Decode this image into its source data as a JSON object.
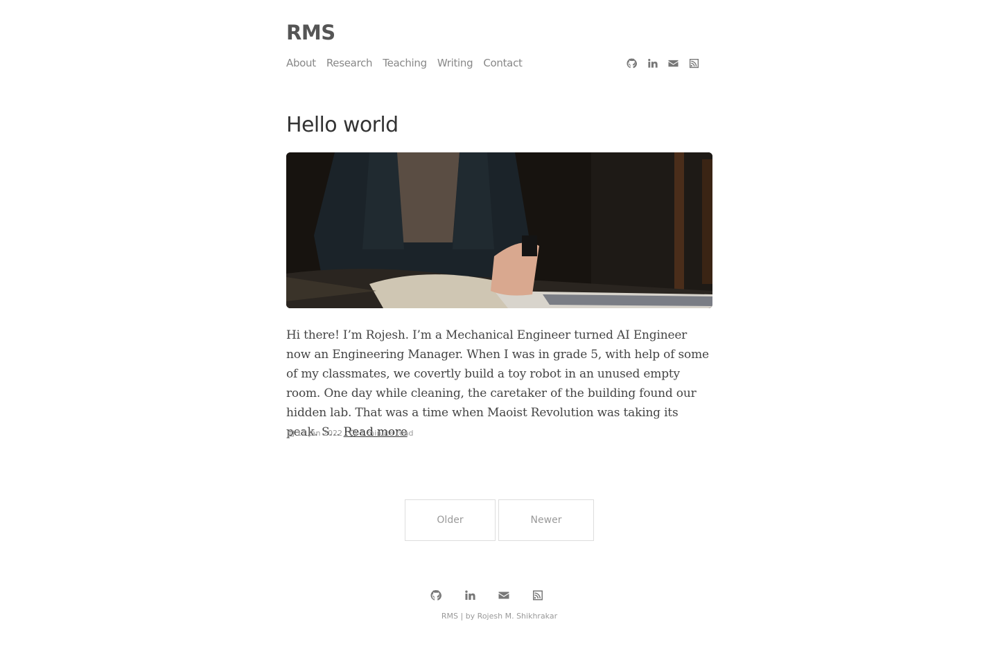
{
  "site": {
    "title": "RMS"
  },
  "nav": {
    "items": [
      {
        "label": "About"
      },
      {
        "label": "Research"
      },
      {
        "label": "Teaching"
      },
      {
        "label": "Writing"
      },
      {
        "label": "Contact"
      }
    ]
  },
  "social": {
    "icons": [
      "github-icon",
      "linkedin-icon",
      "envelope-icon",
      "rss-icon"
    ]
  },
  "post": {
    "title": "Hello world",
    "excerpt": "Hi there! I’m Rojesh. I’m a Mechanical Engineer turned AI Engineer now an Engineering Manager. When I was in grade 5, with help of some of my classmates, we covertly build a toy robot in an unused empty room. One day while cleaning, the caretaker of the building found our hidden lab. That was a time when Maoist Revolution was taking its peak. S...",
    "read_more": "Read more",
    "date": "17 Jan 2022",
    "separator": "-",
    "read_time": "1 minute read"
  },
  "pager": {
    "older": "Older",
    "newer": "Newer"
  },
  "footer": {
    "text": "RMS | by Rojesh M. Shikhrakar"
  }
}
